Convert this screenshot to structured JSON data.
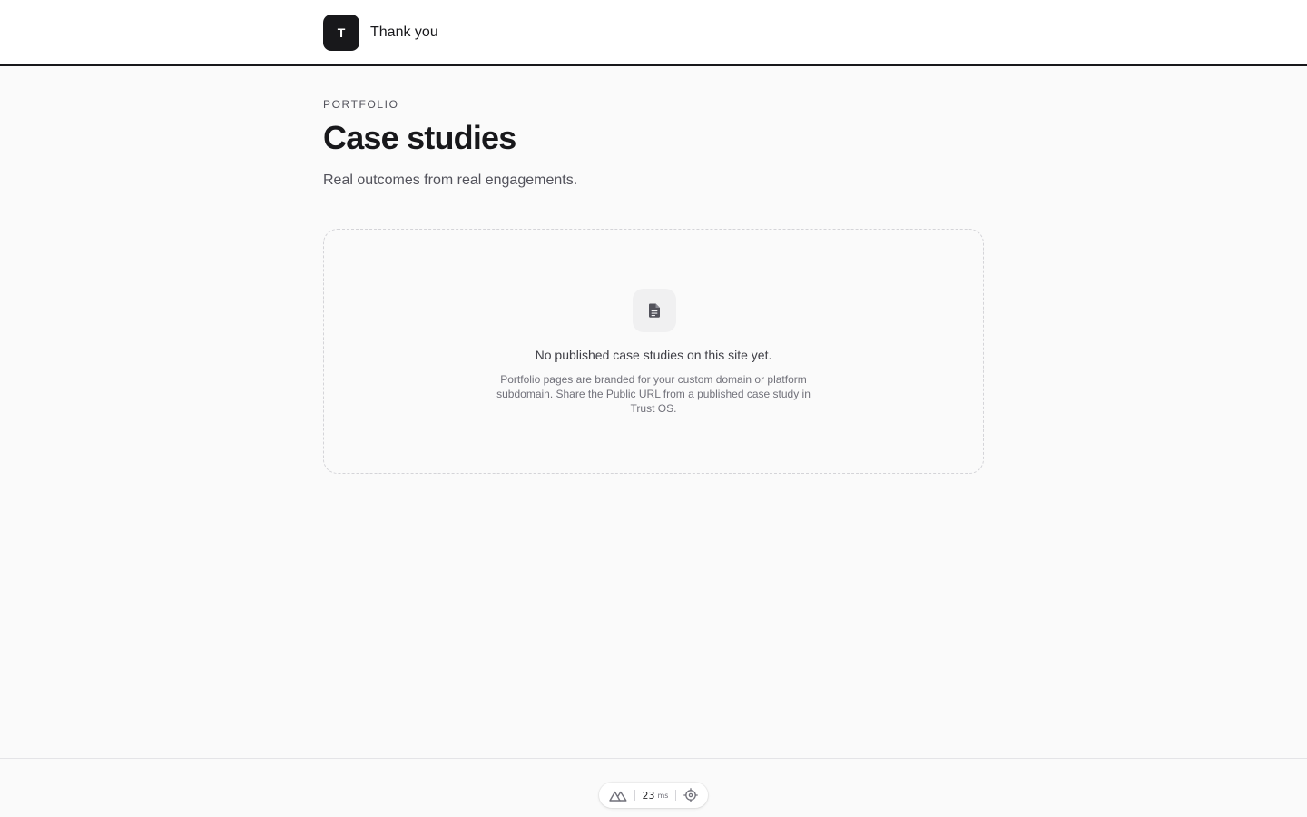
{
  "header": {
    "logo_letter": "T",
    "site_name": "Thank you"
  },
  "page": {
    "eyebrow": "PORTFOLIO",
    "title": "Case studies",
    "subtitle": "Real outcomes from real engagements."
  },
  "empty_state": {
    "icon": "document-icon",
    "title": "No published case studies on this site yet.",
    "description": "Portfolio pages are branded for your custom domain or platform subdomain. Share the Public URL from a published case study in Trust OS."
  },
  "devtools": {
    "logo_icon": "nuxt-logo-icon",
    "render_time": "23",
    "render_unit": "ms",
    "inspect_icon": "crosshair-icon"
  },
  "colors": {
    "background": "#fafafa",
    "header_background": "#ffffff",
    "brand_dark": "#18181b",
    "muted_text": "#52525b",
    "border": "#d4d4d8"
  }
}
